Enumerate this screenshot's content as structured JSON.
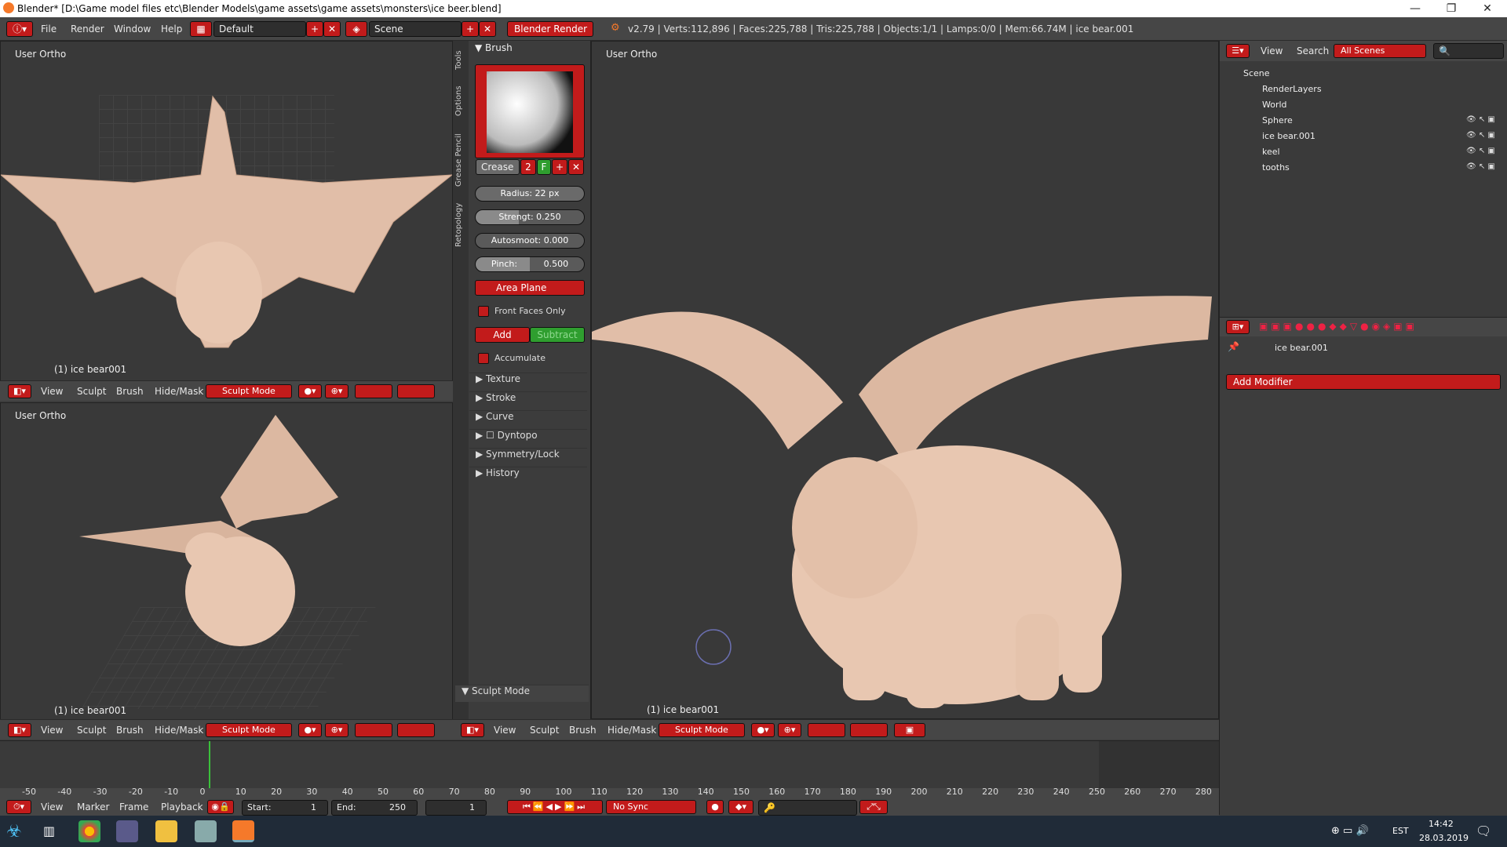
{
  "window": {
    "title": "Blender* [D:\\Game model files etc\\Blender Models\\game assets\\game assets\\monsters\\ice beer.blend]",
    "controls": [
      "—",
      "❐",
      "✕"
    ]
  },
  "info_header": {
    "menus": [
      "File",
      "Render",
      "Window",
      "Help"
    ],
    "screen_layout": "Default",
    "scene": "Scene",
    "render_engine": "Blender Render",
    "stats": "v2.79 | Verts:112,896 | Faces:225,788 | Tris:225,788 | Objects:1/1 | Lamps:0/0 | Mem:66.74M | ice bear.001"
  },
  "viewports": {
    "top_left": {
      "label": "User Ortho",
      "object": "(1) ice bear001"
    },
    "bottom_left": {
      "label": "User Ortho",
      "object": "(1) ice bear001"
    },
    "main": {
      "label": "User Ortho",
      "object": "(1) ice bear001"
    }
  },
  "view_header": {
    "menus": [
      "View",
      "Sculpt",
      "Brush",
      "Hide/Mask"
    ],
    "mode": "Sculpt Mode"
  },
  "tool_tabs": [
    "Tools",
    "Options",
    "Grease Pencil",
    "Retopology"
  ],
  "brush_panel": {
    "title": "Brush",
    "brush_name": "Crease",
    "users": "2",
    "fake_user": "F",
    "radius": "Radius:  22 px",
    "strength": "Strengt: 0.250",
    "autosmooth": "Autosmoot: 0.000",
    "pinch_label": "Pinch:",
    "pinch_value": "0.500",
    "plane": "Area Plane",
    "front_faces": "Front Faces Only",
    "add": "Add",
    "subtract": "Subtract",
    "accumulate": "Accumulate",
    "sections": [
      "Texture",
      "Stroke",
      "Curve",
      "Dyntopo",
      "Symmetry/Lock",
      "History"
    ],
    "footer": "Sculpt Mode"
  },
  "outliner": {
    "menus": [
      "View",
      "Search"
    ],
    "filter": "All Scenes",
    "items": [
      {
        "name": "Scene",
        "indent": 0
      },
      {
        "name": "RenderLayers",
        "indent": 1
      },
      {
        "name": "World",
        "indent": 1
      },
      {
        "name": "Sphere",
        "indent": 1
      },
      {
        "name": "ice bear.001",
        "indent": 1
      },
      {
        "name": "keel",
        "indent": 1
      },
      {
        "name": "tooths",
        "indent": 1
      }
    ]
  },
  "properties": {
    "object_name": "ice bear.001",
    "add_modifier": "Add Modifier"
  },
  "timeline": {
    "ticks": [
      "-50",
      "-40",
      "-30",
      "-20",
      "-10",
      "0",
      "10",
      "20",
      "30",
      "40",
      "50",
      "60",
      "70",
      "80",
      "90",
      "100",
      "110",
      "120",
      "130",
      "140",
      "150",
      "160",
      "170",
      "180",
      "190",
      "200",
      "210",
      "220",
      "230",
      "240",
      "250",
      "260",
      "270",
      "280"
    ],
    "menus": [
      "View",
      "Marker",
      "Frame",
      "Playback"
    ],
    "start": "Start:",
    "start_value": "1",
    "end": "End:",
    "end_value": "250",
    "current": "1",
    "sync": "No Sync"
  },
  "taskbar": {
    "lang": "EST",
    "time": "14:42",
    "date": "28.03.2019"
  },
  "colors": {
    "accent_red": "#c21b1b",
    "green": "#2f9e2f",
    "model": "#e8c7b1"
  }
}
